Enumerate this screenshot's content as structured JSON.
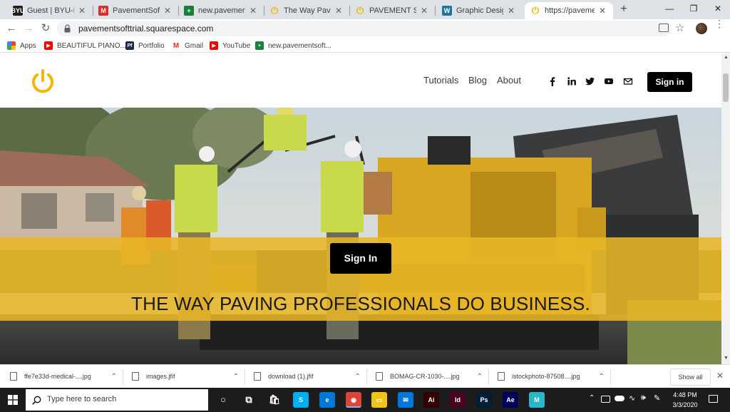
{
  "browser": {
    "tabs": [
      {
        "title": "Guest | BYU-Idaho",
        "favicon": "byu-icon",
        "color": "#1f1f1f",
        "glyph": "BYU"
      },
      {
        "title": "PavementSoft New",
        "favicon": "gmail-icon",
        "color": "#d93025",
        "glyph": "M"
      },
      {
        "title": "new.pavementsoft",
        "favicon": "sheets-icon",
        "color": "#188038",
        "glyph": "+"
      },
      {
        "title": "The Way Paving P",
        "favicon": "power-icon",
        "color": "#f2b705",
        "glyph": "⏻"
      },
      {
        "title": "PAVEMENT SOFTW",
        "favicon": "power-icon",
        "color": "#f2b705",
        "glyph": "⏻"
      },
      {
        "title": "Graphic Design Int",
        "favicon": "wordpress-icon",
        "color": "#21759b",
        "glyph": "W"
      },
      {
        "title": "https://pavement",
        "favicon": "power-icon",
        "color": "#f2b705",
        "glyph": "⏻"
      }
    ],
    "new_tab_glyph": "+",
    "url": "pavementsofttrial.squarespace.com",
    "bookmarks": [
      {
        "label": "Apps",
        "icon": "apps-grid-icon",
        "color": "#4285f4",
        "glyph": ""
      },
      {
        "label": "BEAUTIFUL PIANO...",
        "icon": "youtube-icon",
        "color": "#ff0000",
        "glyph": "▶"
      },
      {
        "label": "Portfolio",
        "icon": "portfolio-icon",
        "color": "#1c2a4a",
        "glyph": "Pf"
      },
      {
        "label": "Gmail",
        "icon": "gmail-icon",
        "color": "#d93025",
        "glyph": "M"
      },
      {
        "label": "YouTube",
        "icon": "youtube-icon",
        "color": "#ff0000",
        "glyph": "▶"
      },
      {
        "label": "new.pavementsoft...",
        "icon": "sheets-icon",
        "color": "#188038",
        "glyph": "+"
      }
    ]
  },
  "site": {
    "nav": [
      "Tutorials",
      "Blog",
      "About"
    ],
    "social_icons": [
      "facebook-icon",
      "linkedin-icon",
      "twitter-icon",
      "youtube-icon",
      "email-icon"
    ],
    "sign_in_top": "Sign in",
    "hero_button": "Sign In",
    "tagline": "THE WAY PAVING PROFESSIONALS DO BUSINESS.",
    "accent": "#f2b705"
  },
  "downloads": {
    "items": [
      "ffe7e33d-medical-....jpg",
      "images.jfif",
      "download (1).jfif",
      "BOMAG-CR-1030-....jpg",
      "istockphoto-87508....jpg"
    ],
    "show_all": "Show all"
  },
  "taskbar": {
    "search_placeholder": "Type here to search",
    "apps": [
      {
        "name": "cortana-icon",
        "glyph": "○",
        "color": "transparent"
      },
      {
        "name": "task-view-icon",
        "glyph": "⧉",
        "color": "transparent"
      },
      {
        "name": "store-icon",
        "glyph": "🛍",
        "color": "transparent"
      },
      {
        "name": "skype-icon",
        "glyph": "S",
        "color": "#00aff0"
      },
      {
        "name": "edge-icon",
        "glyph": "e",
        "color": "#0078d7"
      },
      {
        "name": "chrome-icon",
        "glyph": "◉",
        "color": "#db4437"
      },
      {
        "name": "file-explorer-icon",
        "glyph": "▭",
        "color": "#f0c419"
      },
      {
        "name": "mail-icon",
        "glyph": "✉",
        "color": "#0078d7"
      },
      {
        "name": "illustrator-icon",
        "glyph": "Ai",
        "color": "#330000"
      },
      {
        "name": "indesign-icon",
        "glyph": "Id",
        "color": "#49021f"
      },
      {
        "name": "photoshop-icon",
        "glyph": "Ps",
        "color": "#001e36"
      },
      {
        "name": "after-effects-icon",
        "glyph": "Ae",
        "color": "#00005b"
      },
      {
        "name": "m-app-icon",
        "glyph": "M",
        "color": "#2ab8c8"
      }
    ],
    "time": "4:48 PM",
    "date": "3/3/2020"
  }
}
